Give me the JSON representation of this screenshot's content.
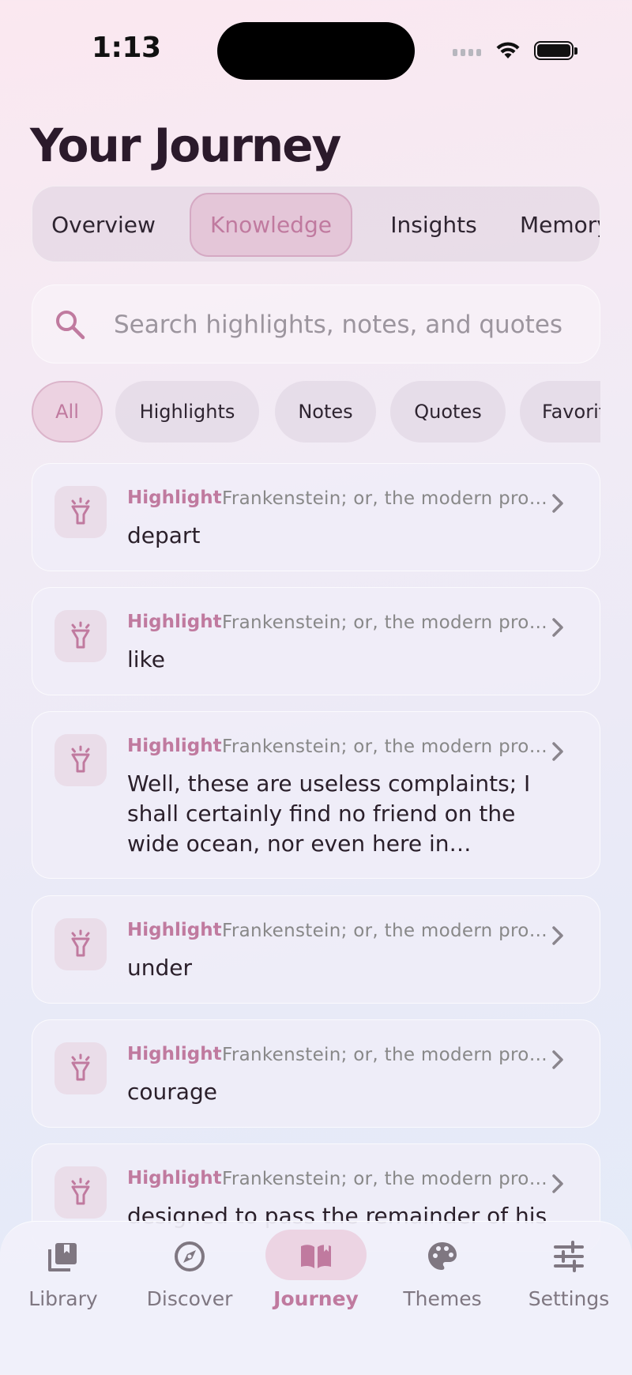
{
  "status_bar": {
    "time": "1:13"
  },
  "page": {
    "title": "Your Journey"
  },
  "tabs": [
    {
      "label": "Overview",
      "active": false
    },
    {
      "label": "Knowledge",
      "active": true
    },
    {
      "label": "Insights",
      "active": false
    },
    {
      "label": "Memory",
      "active": false
    }
  ],
  "search": {
    "placeholder": "Search highlights, notes, and quotes",
    "value": ""
  },
  "filters": [
    {
      "label": "All",
      "active": true
    },
    {
      "label": "Highlights",
      "active": false
    },
    {
      "label": "Notes",
      "active": false
    },
    {
      "label": "Quotes",
      "active": false
    },
    {
      "label": "Favorites",
      "active": false
    }
  ],
  "items": [
    {
      "kind": "Highlight",
      "source": "Frankenstein; or, the modern prometheus",
      "text": "depart",
      "icon": "flashlight-icon"
    },
    {
      "kind": "Highlight",
      "source": "Frankenstein; or, the modern prometheus",
      "text": "like",
      "icon": "flashlight-icon"
    },
    {
      "kind": "Highlight",
      "source": "Frankenstein; or, the modern prometheus",
      "text": "Well, these are useless complaints; I shall certainly find no friend on the wide ocean, nor even here in Archangel",
      "icon": "flashlight-icon"
    },
    {
      "kind": "Highlight",
      "source": "Frankenstein; or, the modern prometheus",
      "text": "under",
      "icon": "flashlight-icon"
    },
    {
      "kind": "Highlight",
      "source": "Frankenstein; or, the modern prometheus",
      "text": "courage",
      "icon": "flashlight-icon"
    },
    {
      "kind": "Highlight",
      "source": "Frankenstein; or, the modern prometheus",
      "text": "designed to pass the remainder of his",
      "icon": "flashlight-icon"
    }
  ],
  "nav": [
    {
      "label": "Library",
      "icon": "library-icon",
      "active": false
    },
    {
      "label": "Discover",
      "icon": "compass-icon",
      "active": false
    },
    {
      "label": "Journey",
      "icon": "book-icon",
      "active": true
    },
    {
      "label": "Themes",
      "icon": "palette-icon",
      "active": false
    },
    {
      "label": "Settings",
      "icon": "sliders-icon",
      "active": false
    }
  ],
  "colors": {
    "accent": "#c07a9f",
    "accent_bg": "#ecd4e3",
    "text": "#2a1f2a",
    "muted": "#888888"
  }
}
